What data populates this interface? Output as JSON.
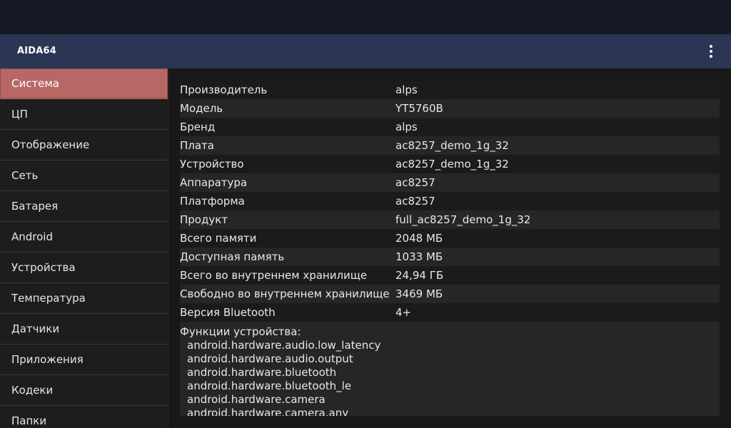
{
  "app": {
    "title": "AIDA64"
  },
  "sidebar": {
    "items": [
      {
        "label": "Система",
        "active": true
      },
      {
        "label": "ЦП"
      },
      {
        "label": "Отображение"
      },
      {
        "label": "Сеть"
      },
      {
        "label": "Батарея"
      },
      {
        "label": "Android"
      },
      {
        "label": "Устройства"
      },
      {
        "label": "Температура"
      },
      {
        "label": "Датчики"
      },
      {
        "label": "Приложения"
      },
      {
        "label": "Кодеки"
      },
      {
        "label": "Папки"
      }
    ]
  },
  "system": {
    "rows": [
      {
        "key": "Производитель",
        "value": "alps"
      },
      {
        "key": "Модель",
        "value": "YT5760B"
      },
      {
        "key": "Бренд",
        "value": "alps"
      },
      {
        "key": "Плата",
        "value": "ac8257_demo_1g_32"
      },
      {
        "key": "Устройство",
        "value": "ac8257_demo_1g_32"
      },
      {
        "key": "Аппаратура",
        "value": "ac8257"
      },
      {
        "key": "Платформа",
        "value": "ac8257"
      },
      {
        "key": "Продукт",
        "value": "full_ac8257_demo_1g_32"
      },
      {
        "key": "Всего памяти",
        "value": "2048 МБ"
      },
      {
        "key": "Доступная память",
        "value": "1033 МБ"
      },
      {
        "key": "Всего во внутреннем хранилище",
        "value": "24,94 ГБ"
      },
      {
        "key": "Свободно во внутреннем хранилище",
        "value": "3469 МБ"
      },
      {
        "key": "Версия Bluetooth",
        "value": "4+"
      }
    ],
    "features_title": "Функции устройства:",
    "features": [
      "android.hardware.audio.low_latency",
      "android.hardware.audio.output",
      "android.hardware.bluetooth",
      "android.hardware.bluetooth_le",
      "android.hardware.camera",
      "android.hardware.camera.any"
    ]
  },
  "colors": {
    "appbar": "#2b3654",
    "statusbar": "#151925",
    "active_item": "#b86765"
  },
  "icons": {
    "overflow": "more-vert-icon"
  }
}
